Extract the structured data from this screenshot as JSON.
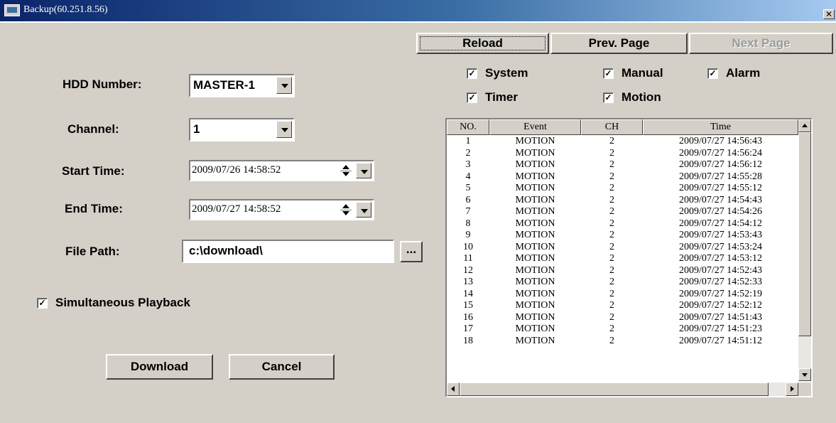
{
  "window": {
    "title": "Backup(60.251.8.56)",
    "close_label": "✕"
  },
  "toolbar": {
    "reload": "Reload",
    "prev": "Prev. Page",
    "next": "Next Page"
  },
  "form": {
    "hdd_label": "HDD Number:",
    "hdd_value": "MASTER-1",
    "channel_label": "Channel:",
    "channel_value": "1",
    "start_label": "Start Time:",
    "start_value": "2009/07/26 14:58:52",
    "end_label": "End Time:",
    "end_value": "2009/07/27 14:58:52",
    "path_label": "File Path:",
    "path_value": "c:\\download\\",
    "browse_label": "...",
    "simul_label": "Simultaneous Playback",
    "simul_checked": true,
    "download_label": "Download",
    "cancel_label": "Cancel"
  },
  "filters": [
    {
      "label": "System",
      "checked": true
    },
    {
      "label": "Manual",
      "checked": true
    },
    {
      "label": "Alarm",
      "checked": true
    },
    {
      "label": "Timer",
      "checked": true
    },
    {
      "label": "Motion",
      "checked": true
    }
  ],
  "check_mark": "✓",
  "table": {
    "columns": [
      "NO.",
      "Event",
      "CH",
      "Time"
    ],
    "rows": [
      [
        "1",
        "MOTION",
        "2",
        "2009/07/27 14:56:43"
      ],
      [
        "2",
        "MOTION",
        "2",
        "2009/07/27 14:56:24"
      ],
      [
        "3",
        "MOTION",
        "2",
        "2009/07/27 14:56:12"
      ],
      [
        "4",
        "MOTION",
        "2",
        "2009/07/27 14:55:28"
      ],
      [
        "5",
        "MOTION",
        "2",
        "2009/07/27 14:55:12"
      ],
      [
        "6",
        "MOTION",
        "2",
        "2009/07/27 14:54:43"
      ],
      [
        "7",
        "MOTION",
        "2",
        "2009/07/27 14:54:26"
      ],
      [
        "8",
        "MOTION",
        "2",
        "2009/07/27 14:54:12"
      ],
      [
        "9",
        "MOTION",
        "2",
        "2009/07/27 14:53:43"
      ],
      [
        "10",
        "MOTION",
        "2",
        "2009/07/27 14:53:24"
      ],
      [
        "11",
        "MOTION",
        "2",
        "2009/07/27 14:53:12"
      ],
      [
        "12",
        "MOTION",
        "2",
        "2009/07/27 14:52:43"
      ],
      [
        "13",
        "MOTION",
        "2",
        "2009/07/27 14:52:33"
      ],
      [
        "14",
        "MOTION",
        "2",
        "2009/07/27 14:52:19"
      ],
      [
        "15",
        "MOTION",
        "2",
        "2009/07/27 14:52:12"
      ],
      [
        "16",
        "MOTION",
        "2",
        "2009/07/27 14:51:43"
      ],
      [
        "17",
        "MOTION",
        "2",
        "2009/07/27 14:51:23"
      ],
      [
        "18",
        "MOTION",
        "2",
        "2009/07/27 14:51:12"
      ]
    ]
  }
}
